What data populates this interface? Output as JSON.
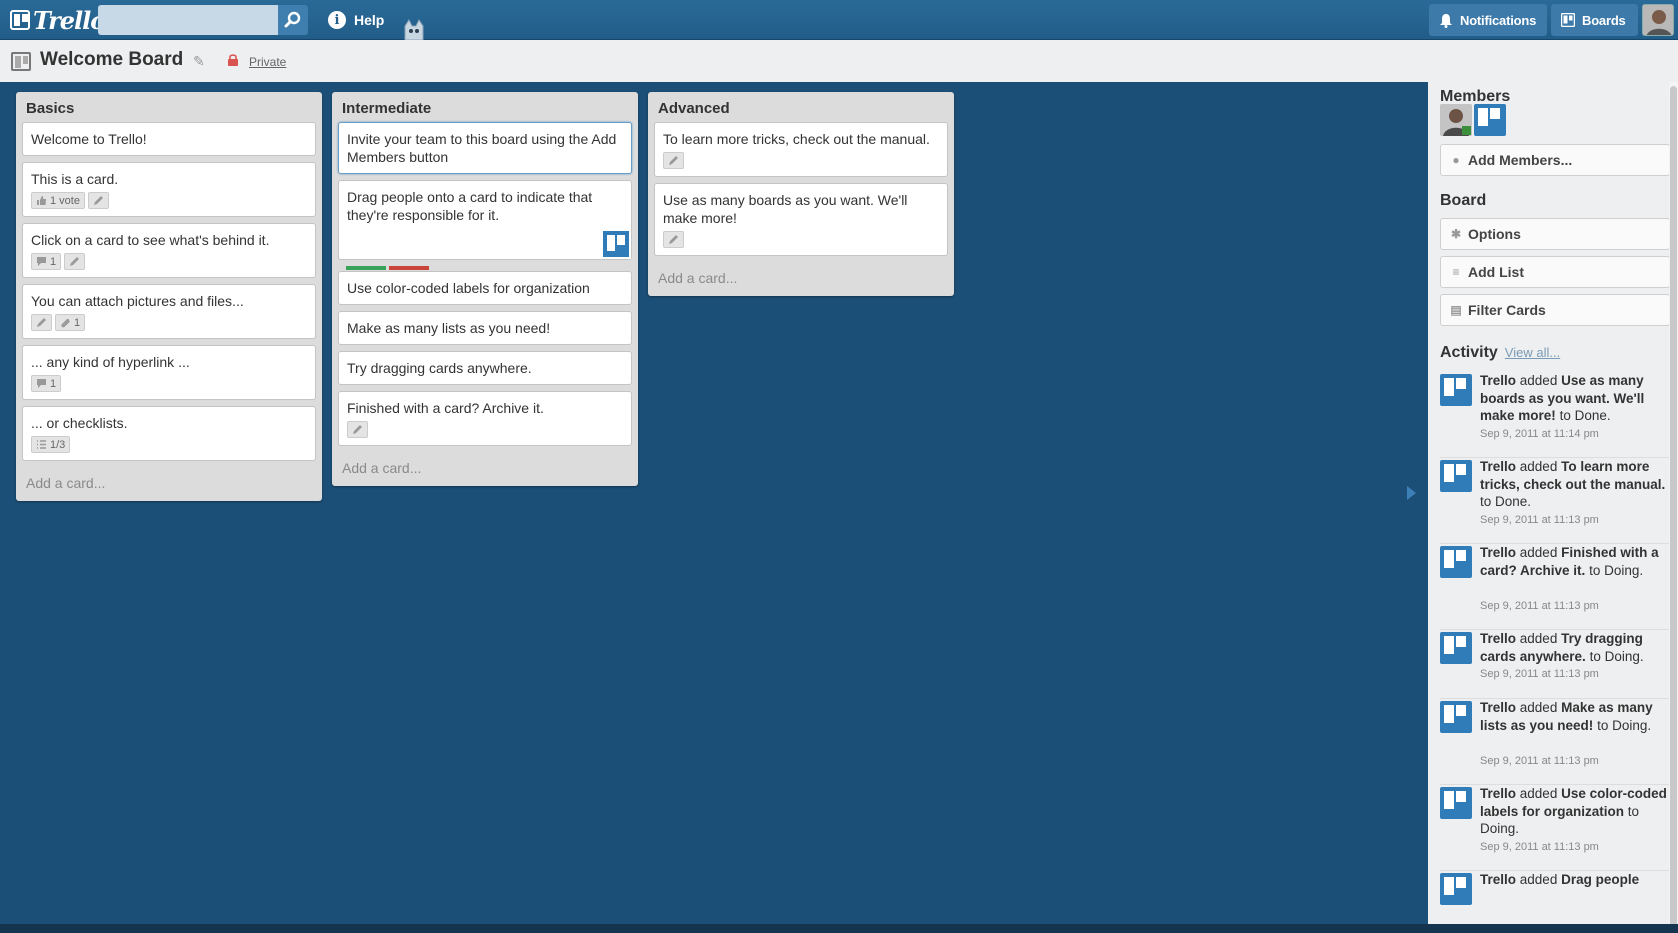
{
  "header": {
    "logo_text": "Trello",
    "search_placeholder": "",
    "help_label": "Help",
    "notifications_label": "Notifications",
    "boards_label": "Boards"
  },
  "board": {
    "title": "Welcome Board",
    "privacy": "Private"
  },
  "lists": [
    {
      "name": "Basics",
      "add_card": "Add a card...",
      "cards": [
        {
          "title": "Welcome to Trello!"
        },
        {
          "title": "This is a card.",
          "votes": "1 vote"
        },
        {
          "title": "Click on a card to see what's behind it.",
          "comments": "1"
        },
        {
          "title": "You can attach pictures and files...",
          "attachments": "1"
        },
        {
          "title": "... any kind of hyperlink ...",
          "comments": "1"
        },
        {
          "title": "... or checklists.",
          "checklist": "1/3"
        }
      ]
    },
    {
      "name": "Intermediate",
      "add_card": "Add a card...",
      "cards": [
        {
          "title": "Invite your team to this board using the Add Members button"
        },
        {
          "title": "Drag people onto a card to indicate that they're responsible for it."
        },
        {
          "title": "Use color-coded labels for organization",
          "labels": [
            "#3aa35b",
            "#c9453a"
          ]
        },
        {
          "title": "Make as many lists as you need!"
        },
        {
          "title": "Try dragging cards anywhere."
        },
        {
          "title": "Finished with a card? Archive it."
        }
      ]
    },
    {
      "name": "Advanced",
      "add_card": "Add a card...",
      "cards": [
        {
          "title": "To learn more tricks, check out the manual."
        },
        {
          "title": "Use as many boards as you want. We'll make more!"
        }
      ]
    }
  ],
  "sidebar": {
    "members_heading": "Members",
    "add_members": "Add Members...",
    "board_heading": "Board",
    "options": "Options",
    "add_list": "Add List",
    "filter_cards": "Filter Cards",
    "activity_heading": "Activity",
    "view_all": "View all...",
    "activity": [
      {
        "actor": "Trello",
        "verb": "added",
        "item": "Use as many boards as you want. We'll make more!",
        "dest": "to Done.",
        "time": "Sep 9, 2011 at 11:14 pm"
      },
      {
        "actor": "Trello",
        "verb": "added",
        "item": "To learn more tricks, check out the manual.",
        "dest": "to Done.",
        "time": "Sep 9, 2011 at 11:13 pm"
      },
      {
        "actor": "Trello",
        "verb": "added",
        "item": "Finished with a card? Archive it.",
        "dest": "to Doing.",
        "time": "Sep 9, 2011 at 11:13 pm"
      },
      {
        "actor": "Trello",
        "verb": "added",
        "item": "Try dragging cards anywhere.",
        "dest": "to Doing.",
        "time": "Sep 9, 2011 at 11:13 pm"
      },
      {
        "actor": "Trello",
        "verb": "added",
        "item": "Make as many lists as you need!",
        "dest": "to Doing.",
        "time": "Sep 9, 2011 at 11:13 pm"
      },
      {
        "actor": "Trello",
        "verb": "added",
        "item": "Use color-coded labels for organization",
        "dest": "to Doing.",
        "time": "Sep 9, 2011 at 11:13 pm"
      },
      {
        "actor": "Trello",
        "verb": "added",
        "item": "Drag people",
        "dest": "",
        "time": ""
      }
    ]
  },
  "colors": {
    "header": "#245f8c",
    "board_bg": "#1c4f77",
    "list_bg": "#dcdcdc",
    "label_green": "#3aa35b",
    "label_red": "#c9453a"
  }
}
